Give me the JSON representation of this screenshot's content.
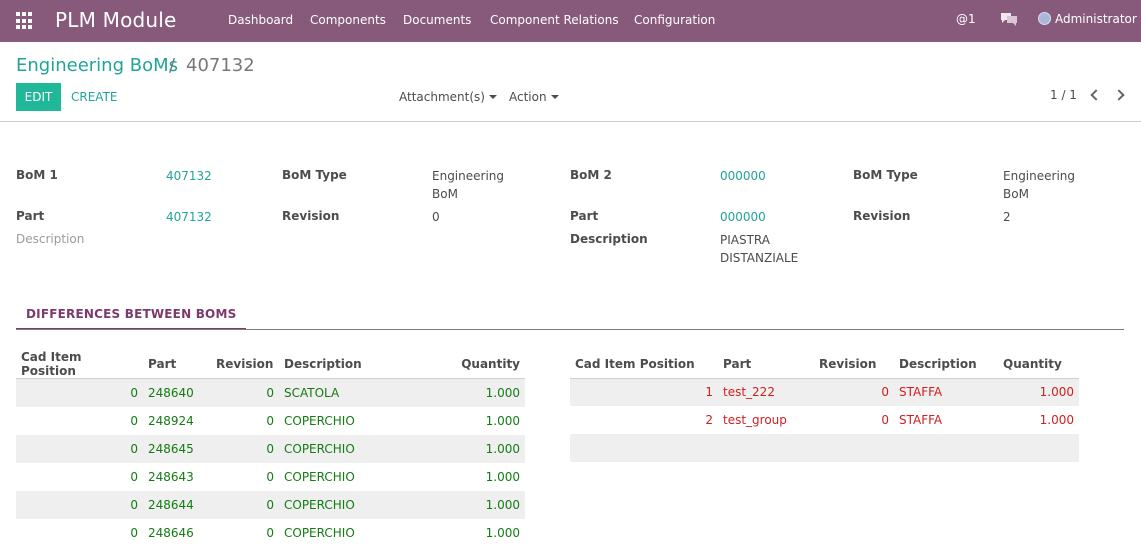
{
  "topbar": {
    "app_title": "PLM Module",
    "menu": [
      "Dashboard",
      "Components",
      "Documents",
      "Component Relations",
      "Configuration"
    ],
    "mentions": "@1",
    "user": "Administrator"
  },
  "breadcrumb": {
    "parent": "Engineering BoMs",
    "separator": "/",
    "current": "407132"
  },
  "buttons": {
    "edit": "EDIT",
    "create": "CREATE",
    "attachments": "Attachment(s)",
    "action": "Action"
  },
  "pager": "1 / 1",
  "form": {
    "left": {
      "bom_label": "BoM 1",
      "bom_value": "407132",
      "type_label": "BoM Type",
      "type_value_1": "Engineering",
      "type_value_2": "BoM",
      "part_label": "Part",
      "part_value": "407132",
      "revision_label": "Revision",
      "revision_value": "0",
      "description_label": "Description"
    },
    "right": {
      "bom_label": "BoM 2",
      "bom_value": "000000",
      "type_label": "BoM Type",
      "type_value_1": "Engineering",
      "type_value_2": "BoM",
      "part_label": "Part",
      "part_value": "000000",
      "revision_label": "Revision",
      "revision_value": "2",
      "description_label": "Description",
      "description_value_1": "PIASTRA",
      "description_value_2": "DISTANZIALE"
    }
  },
  "tab_label": "DIFFERENCES BETWEEN BOMS",
  "table_headers": [
    "Cad Item Position",
    "Part",
    "Revision",
    "Description",
    "Quantity"
  ],
  "left_rows": [
    {
      "pos": "0",
      "part": "248640",
      "rev": "0",
      "desc": "SCATOLA",
      "qty": "1.000"
    },
    {
      "pos": "0",
      "part": "248924",
      "rev": "0",
      "desc": "COPERCHIO",
      "qty": "1.000"
    },
    {
      "pos": "0",
      "part": "248645",
      "rev": "0",
      "desc": "COPERCHIO",
      "qty": "1.000"
    },
    {
      "pos": "0",
      "part": "248643",
      "rev": "0",
      "desc": "COPERCHIO",
      "qty": "1.000"
    },
    {
      "pos": "0",
      "part": "248644",
      "rev": "0",
      "desc": "COPERCHIO",
      "qty": "1.000"
    },
    {
      "pos": "0",
      "part": "248646",
      "rev": "0",
      "desc": "COPERCHIO",
      "qty": "1.000"
    }
  ],
  "right_rows": [
    {
      "pos": "1",
      "part": "test_222",
      "rev": "0",
      "desc": "STAFFA",
      "qty": "1.000"
    },
    {
      "pos": "2",
      "part": "test_group",
      "rev": "0",
      "desc": "STAFFA",
      "qty": "1.000"
    }
  ],
  "colors": {
    "topbar": "#875a7b",
    "accent": "#21a498",
    "added": "#137c13",
    "removed": "#cf1f1f"
  }
}
